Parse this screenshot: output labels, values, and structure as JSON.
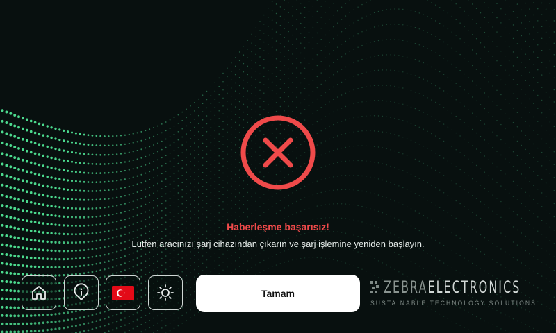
{
  "status": {
    "icon": "x-circle-icon",
    "title": "Haberleşme başarısız!",
    "message": "Lütfen aracınızı şarj cihazından çıkarın ve şarj işlemine yeniden başlayın."
  },
  "toolbar": {
    "home_icon": "home-icon",
    "info_icon": "info-icon",
    "language_icon": "turkey-flag-icon",
    "brightness_icon": "sun-icon"
  },
  "confirm_label": "Tamam",
  "brand": {
    "name_part1": "ZEBRA",
    "name_part2": "ELECTRONICS",
    "tagline": "SUSTAINABLE TECHNOLOGY SOLUTIONS"
  },
  "colors": {
    "background": "#08100f",
    "wave": "#3de38f",
    "error": "#ef4a4a",
    "button": "#ffffff"
  }
}
